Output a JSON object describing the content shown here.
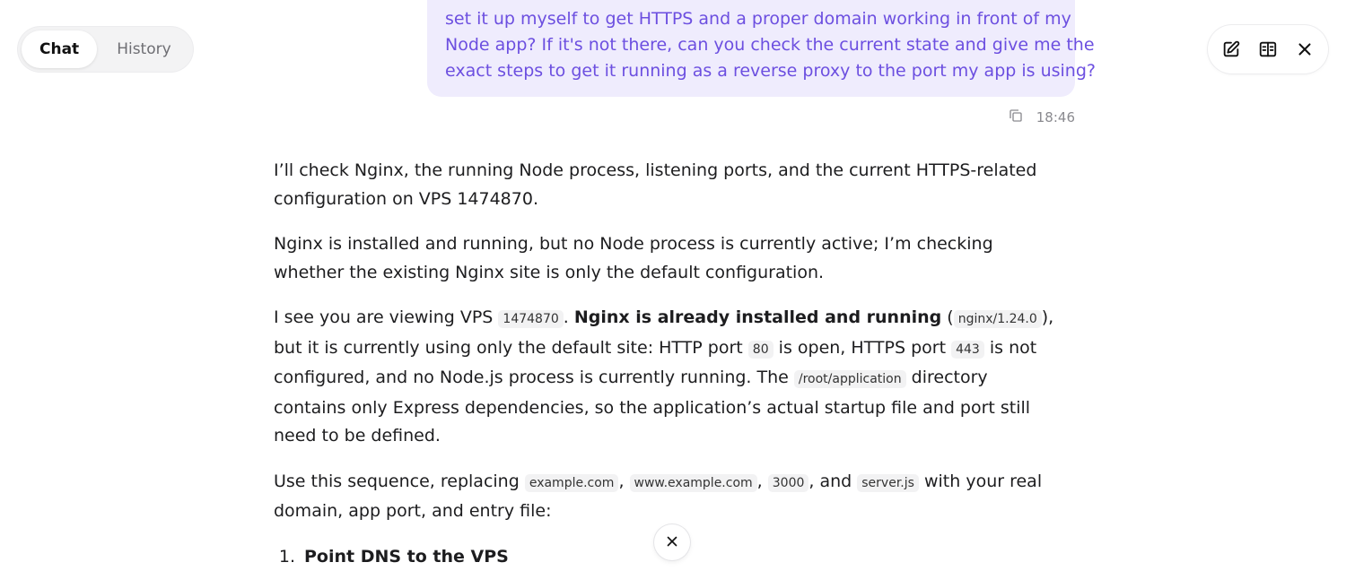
{
  "tabs": [
    {
      "label": "Chat",
      "active": true
    },
    {
      "label": "History",
      "active": false
    }
  ],
  "toolbar": {
    "icons": [
      "edit-icon",
      "split-view-icon",
      "close-icon"
    ]
  },
  "user_message": {
    "lines": [
      "set it up myself to get HTTPS and a proper domain working in front of my",
      "Node app? If it's not there, can you check the current state and give me the",
      "exact steps to get it running as a reverse proxy to the port my app is using?"
    ],
    "time": "18:46"
  },
  "answer": {
    "p1": "I’ll check Nginx, the running Node process, listening ports, and the current HTTPS-related configuration on VPS 1474870.",
    "p2": "Nginx is installed and running, but no Node process is currently active; I’m checking whether the existing Nginx site is only the default configuration.",
    "p3": {
      "t1": "I see you are viewing VPS ",
      "c1": "1474870",
      "t2": ". ",
      "b1": "Nginx is already installed and running",
      "t3": " (",
      "c2": "nginx/1.24.0",
      "t4": "), but it is currently using only the default site: HTTP port ",
      "c3": "80",
      "t5": " is open, HTTPS port ",
      "c4": "443",
      "t6": " is not configured, and no Node.js process is currently running. The ",
      "c5": "/root/application",
      "t7": " directory contains only Express dependencies, so the application’s actual startup file and port still need to be defined."
    },
    "p4": {
      "t1": "Use this sequence, replacing ",
      "c1": "example.com",
      "t2": ", ",
      "c2": "www.example.com",
      "t3": ", ",
      "c3": "3000",
      "t4": ", and ",
      "c4": "server.js",
      "t5": " with your real domain, app port, and entry file:"
    },
    "steps": [
      {
        "num": "1.",
        "title": "Point DNS to the VPS"
      }
    ]
  },
  "colors": {
    "user_bubble_bg": "#efecfd",
    "user_text": "#6c4fe0"
  }
}
